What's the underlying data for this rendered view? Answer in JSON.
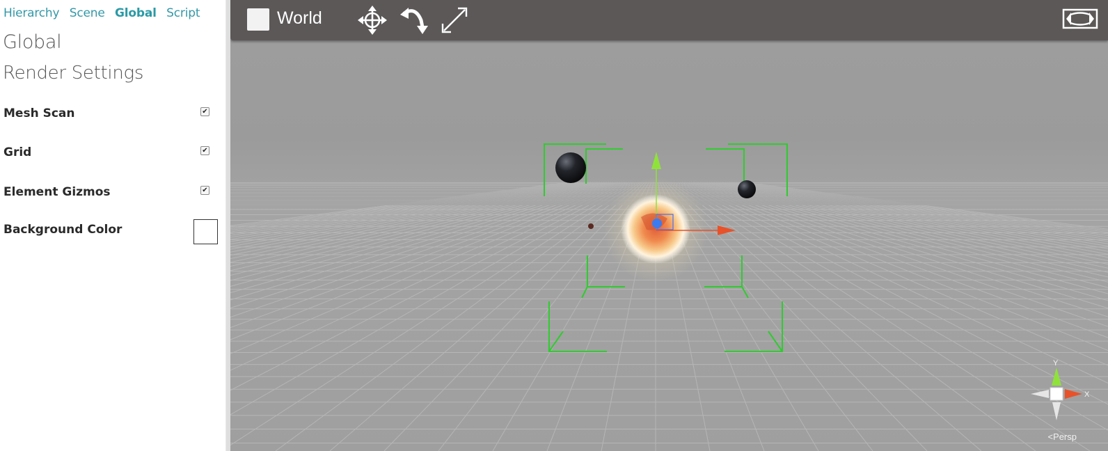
{
  "tabs": [
    {
      "label": "Hierarchy"
    },
    {
      "label": "Scene"
    },
    {
      "label": "Global",
      "active": true
    },
    {
      "label": "Script"
    }
  ],
  "panel": {
    "title": "Global",
    "section_title": "Render Settings",
    "settings": [
      {
        "label": "Mesh Scan",
        "checked": true
      },
      {
        "label": "Grid",
        "checked": true
      },
      {
        "label": "Element Gizmos",
        "checked": true
      },
      {
        "label": "Background Color",
        "value": "#ffffff"
      }
    ]
  },
  "toolbar": {
    "space_label": "World",
    "tools": [
      {
        "name": "move-icon"
      },
      {
        "name": "rotate-icon"
      },
      {
        "name": "scale-icon"
      }
    ],
    "maximize_icon": "maximize-icon"
  },
  "viewport": {
    "axis_labels": {
      "y": "Y",
      "x": "X"
    },
    "projection_label": "<Persp",
    "colors": {
      "background": "#9e9e9e",
      "grid": "#b5b5b5",
      "gizmo_bounds": "#2ecc2e",
      "y_axis": "#8fe23a",
      "x_axis": "#e8522a",
      "z_axis": "#3b7bf0",
      "toolbar": "#5c5858"
    }
  }
}
